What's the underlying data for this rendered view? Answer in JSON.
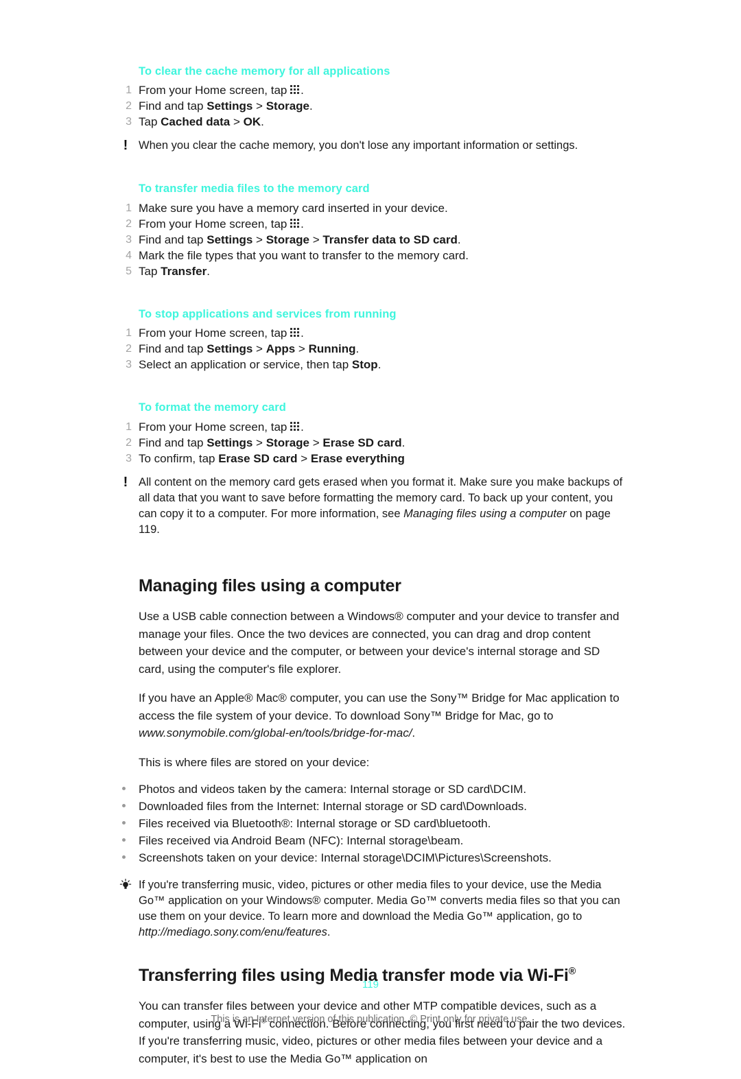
{
  "colors": {
    "accent": "#3ff5dd",
    "text": "#1a1a1a",
    "muted": "#a3a3a3",
    "footer": "#6e6e6e"
  },
  "sections": [
    {
      "heading": "To clear the cache memory for all applications",
      "steps": [
        {
          "num": "1",
          "pre": "From your Home screen, tap ",
          "icon": "apps-grid-icon",
          "post": "."
        },
        {
          "num": "2",
          "pre": "Find and tap ",
          "bold1": "Settings",
          "mid": " > ",
          "bold2": "Storage",
          "post": "."
        },
        {
          "num": "3",
          "pre": "Tap ",
          "bold1": "Cached data",
          "mid": " > ",
          "bold2": "OK",
          "post": "."
        }
      ],
      "note": {
        "icon": "exclamation-icon",
        "text": "When you clear the cache memory, you don't lose any important information or settings."
      }
    },
    {
      "heading": "To transfer media files to the memory card",
      "steps": [
        {
          "num": "1",
          "pre": "Make sure you have a memory card inserted in your device."
        },
        {
          "num": "2",
          "pre": "From your Home screen, tap ",
          "icon": "apps-grid-icon",
          "post": "."
        },
        {
          "num": "3",
          "pre": "Find and tap ",
          "bold1": "Settings",
          "mid": " > ",
          "bold2": "Storage",
          "mid2": " > ",
          "bold3": "Transfer data to SD card",
          "post": "."
        },
        {
          "num": "4",
          "pre": "Mark the file types that you want to transfer to the memory card."
        },
        {
          "num": "5",
          "pre": "Tap ",
          "bold1": "Transfer",
          "post": "."
        }
      ]
    },
    {
      "heading": "To stop applications and services from running",
      "steps": [
        {
          "num": "1",
          "pre": "From your Home screen, tap ",
          "icon": "apps-grid-icon",
          "post": "."
        },
        {
          "num": "2",
          "pre": "Find and tap ",
          "bold1": "Settings",
          "mid": " > ",
          "bold2": "Apps",
          "mid2": " > ",
          "bold3": "Running",
          "post": "."
        },
        {
          "num": "3",
          "pre": "Select an application or service, then tap ",
          "bold1": "Stop",
          "post": "."
        }
      ]
    },
    {
      "heading": "To format the memory card",
      "steps": [
        {
          "num": "1",
          "pre": "From your Home screen, tap ",
          "icon": "apps-grid-icon",
          "post": "."
        },
        {
          "num": "2",
          "pre": "Find and tap ",
          "bold1": "Settings",
          "mid": " > ",
          "bold2": "Storage",
          "mid2": " > ",
          "bold3": "Erase SD card",
          "post": "."
        },
        {
          "num": "3",
          "pre": "To confirm, tap ",
          "bold1": "Erase SD card",
          "mid": " > ",
          "bold2": "Erase everything",
          "post": ""
        }
      ],
      "note": {
        "icon": "exclamation-icon",
        "text_part1": "All content on the memory card gets erased when you format it. Make sure you make backups of all data that you want to save before formatting the memory card. To back up your content, you can copy it to a computer. For more information, see ",
        "italic": "Managing files using a computer",
        "text_part2": " on page 119."
      }
    }
  ],
  "managing_files": {
    "heading": "Managing files using a computer",
    "paragraph_1": "Use a USB cable connection between a Windows® computer and your device to transfer and manage your files. Once the two devices are connected, you can drag and drop content between your device and the computer, or between your device's internal storage and SD card, using the computer's file explorer.",
    "paragraph_2_part1": "If you have an Apple® Mac® computer, you can use the Sony™ Bridge for Mac application to access the file system of your device. To download Sony™ Bridge for Mac, go to ",
    "paragraph_2_url": "www.sonymobile.com/global-en/tools/bridge-for-mac/",
    "paragraph_2_part2": ".",
    "paragraph_3": "This is where files are stored on your device:",
    "bullets": [
      "Photos and videos taken by the camera: Internal storage or SD card\\DCIM.",
      "Downloaded files from the Internet: Internal storage or SD card\\Downloads.",
      "Files received via Bluetooth®: Internal storage or SD card\\bluetooth.",
      "Files received via Android Beam (NFC): Internal storage\\beam.",
      "Screenshots taken on your device: Internal storage\\DCIM\\Pictures\\Screenshots."
    ],
    "tip": {
      "icon": "lightbulb-icon",
      "text_part1": "If you're transferring music, video, pictures or other media files to your device, use the Media Go™ application on your Windows® computer. Media Go™ converts media files so that you can use them on your device. To learn more and download the Media Go™ application, go to ",
      "url": "http://mediago.sony.com/enu/features",
      "text_part2": "."
    }
  },
  "wifi_transfer": {
    "heading_pre": "Transferring files using Media transfer mode via Wi-Fi",
    "heading_sup": "®",
    "paragraph_part1": "You can transfer files between your device and other MTP compatible devices, such as a computer, using a Wi-Fi",
    "paragraph_sup": "®",
    "paragraph_part2": " connection. Before connecting, you first need to pair the two devices. If you're transferring music, video, pictures or other media files between your device and a computer, it's best to use the Media Go™ application on"
  },
  "footer": {
    "page_number": "119",
    "disclaimer": "This is an Internet version of this publication. © Print only for private use."
  }
}
